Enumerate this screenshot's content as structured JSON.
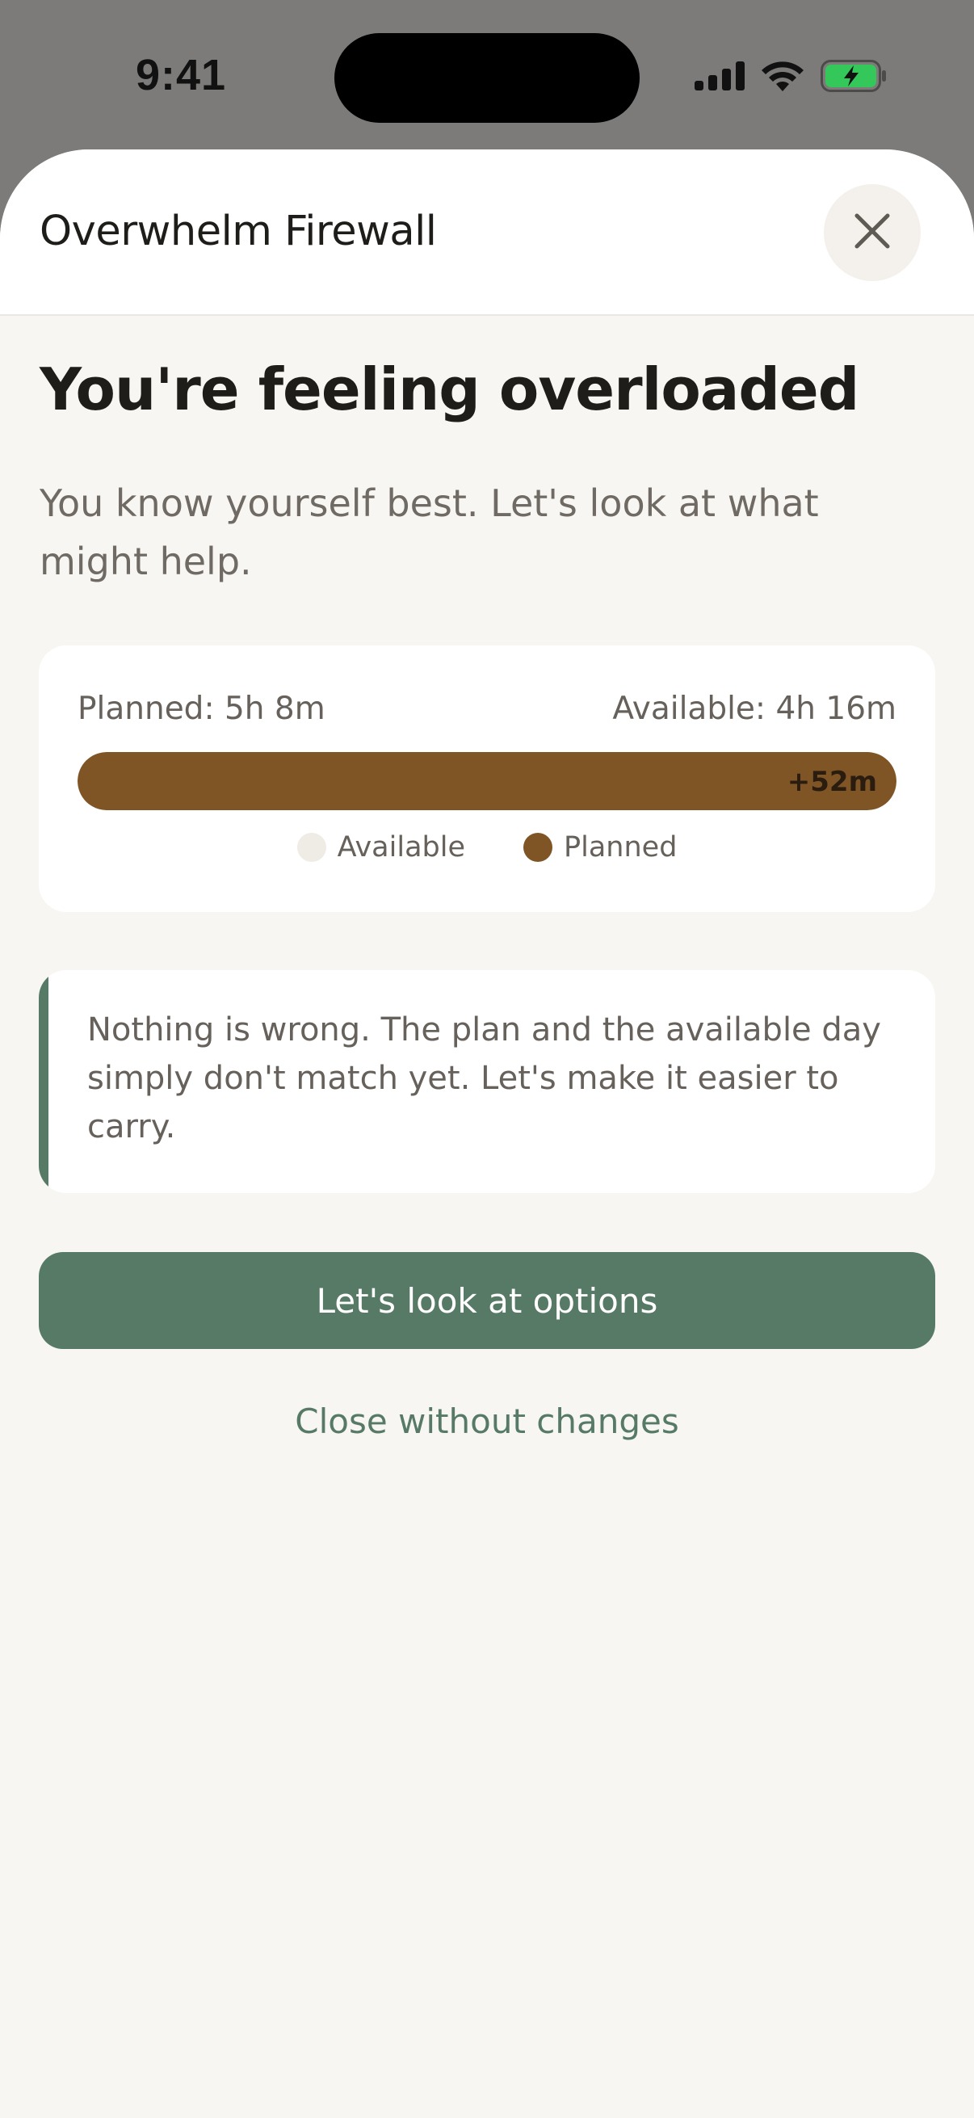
{
  "status_bar": {
    "time": "9:41",
    "icons": [
      "cellular-signal-icon",
      "wifi-icon",
      "battery-charging-icon"
    ],
    "battery_color": "#34c759"
  },
  "sheet": {
    "title": "Overwhelm Firewall",
    "close_icon": "close-icon"
  },
  "main": {
    "headline": "You're feeling overloaded",
    "subtitle": "You know yourself best. Let's look at what might help.",
    "time_summary": {
      "planned_label": "Planned: 5h 8m",
      "available_label": "Available: 4h 16m",
      "planned_minutes": 308,
      "available_minutes": 256,
      "overage_label": "+52m",
      "bar_fill_fraction": 1.0,
      "legend": [
        {
          "label": "Available",
          "color": "#efece6"
        },
        {
          "label": "Planned",
          "color": "#7f5526"
        }
      ]
    },
    "note": "Nothing is wrong. The plan and the available day simply don't match yet. Let's make it easier to carry.",
    "primary_action": "Let's look at options",
    "secondary_action": "Close without changes"
  },
  "colors": {
    "accent_green": "#567a66",
    "planned_brown": "#7f5526",
    "background": "#f8f6f2"
  }
}
